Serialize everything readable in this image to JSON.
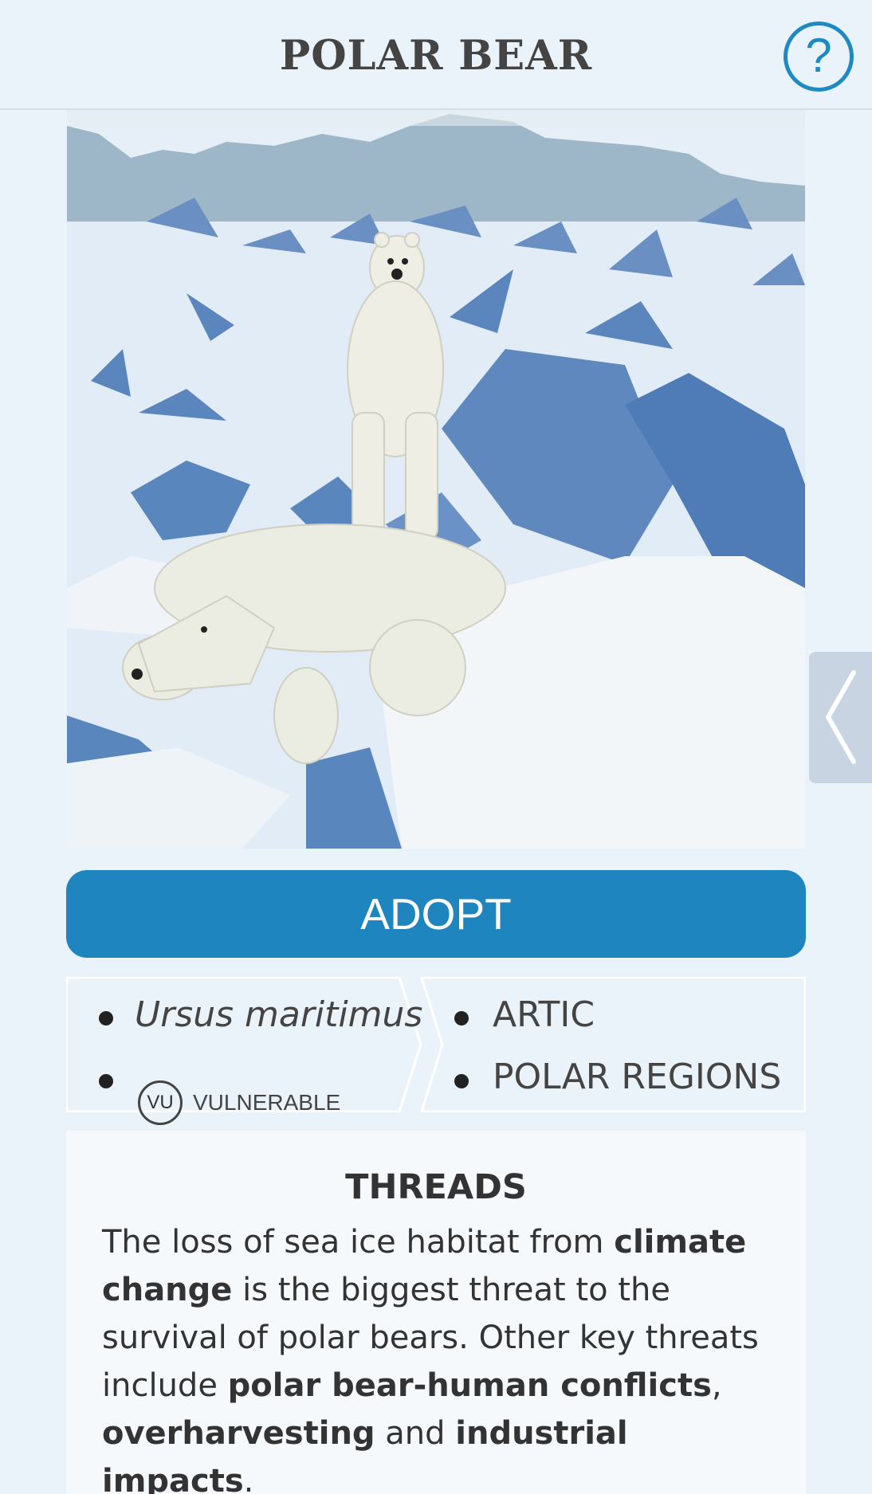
{
  "header": {
    "title": "POLAR BEAR",
    "help_label": "?"
  },
  "actions": {
    "adopt_label": "ADOPT"
  },
  "info": {
    "scientific_name": "Ursus maritimus",
    "status_code": "VU",
    "status_label": "VULNERABLE",
    "regions": [
      "ARTIC",
      "POLAR REGIONS"
    ]
  },
  "threats": {
    "title": "THREADS",
    "segments": [
      "The loss of sea ice habitat from ",
      "climate change",
      " is the biggest threat to the survival of polar bears. Other key threats include ",
      "polar bear-human conflicts",
      ", ",
      "overharvesting",
      " and ",
      "industrial impacts",
      "."
    ]
  },
  "colors": {
    "accent": "#1e85bf",
    "background": "#eaf3fa",
    "ice_blue": "#5b86bd",
    "panel": "#f5f9fc"
  },
  "icons": {
    "help": "question-circle-icon",
    "side_tab": "chevron-left-icon",
    "status": "vu-badge-icon"
  }
}
